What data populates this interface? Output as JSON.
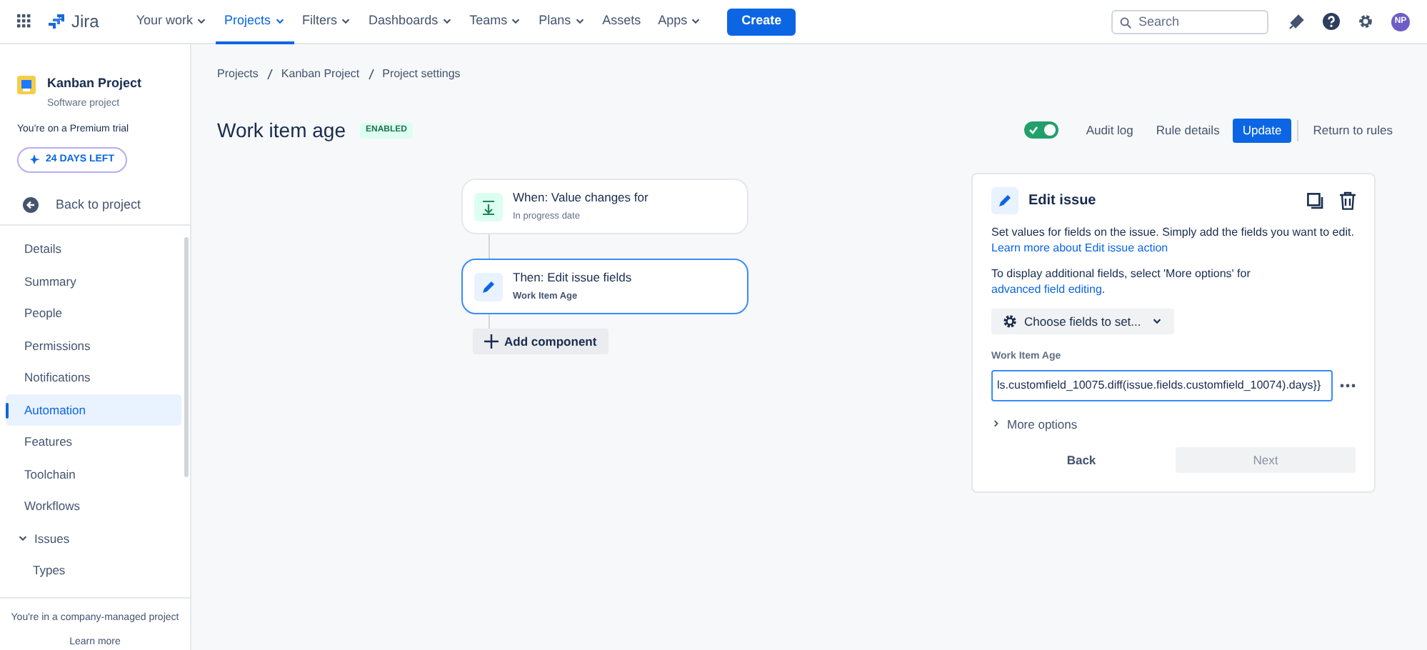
{
  "topbar": {
    "logo": "Jira",
    "nav": [
      {
        "label": "Your work",
        "dropdown": true,
        "selected": false
      },
      {
        "label": "Projects",
        "dropdown": true,
        "selected": true
      },
      {
        "label": "Filters",
        "dropdown": true,
        "selected": false
      },
      {
        "label": "Dashboards",
        "dropdown": true,
        "selected": false
      },
      {
        "label": "Teams",
        "dropdown": true,
        "selected": false
      },
      {
        "label": "Plans",
        "dropdown": true,
        "selected": false
      },
      {
        "label": "Assets",
        "dropdown": false,
        "selected": false
      },
      {
        "label": "Apps",
        "dropdown": true,
        "selected": false
      }
    ],
    "create": "Create",
    "search": {
      "placeholder": "Search"
    },
    "avatar": "NP"
  },
  "sidebar": {
    "project": {
      "name": "Kanban Project",
      "type": "Software project"
    },
    "trial": "You're on a Premium trial",
    "days_left": "24 DAYS LEFT",
    "back": "Back to project",
    "items": [
      {
        "label": "Details",
        "selected": false
      },
      {
        "label": "Summary",
        "selected": false
      },
      {
        "label": "People",
        "selected": false
      },
      {
        "label": "Permissions",
        "selected": false
      },
      {
        "label": "Notifications",
        "selected": false
      },
      {
        "label": "Automation",
        "selected": true
      },
      {
        "label": "Features",
        "selected": false
      },
      {
        "label": "Toolchain",
        "selected": false
      },
      {
        "label": "Workflows",
        "selected": false
      },
      {
        "label": "Issues",
        "selected": false,
        "expanded": true,
        "children": [
          {
            "label": "Types",
            "selected": false
          }
        ]
      }
    ],
    "footer": "You're in a company-managed project",
    "footer_link": "Learn more"
  },
  "breadcrumbs": [
    "Projects",
    "Kanban Project",
    "Project settings"
  ],
  "rule": {
    "title": "Work item age",
    "status": "ENABLED",
    "enabled": true
  },
  "actions": {
    "audit_log": "Audit log",
    "rule_details": "Rule details",
    "update": "Update",
    "return": "Return to rules"
  },
  "flow": [
    {
      "kind": "trigger",
      "title": "When: Value changes for",
      "subtitle": "In progress date",
      "selected": false
    },
    {
      "kind": "action",
      "title": "Then: Edit issue fields",
      "subtitle": "Work Item Age",
      "selected": true
    }
  ],
  "add_component": "Add component",
  "panel": {
    "title": "Edit issue",
    "description": "Set values for fields on the issue. Simply add the fields you want to edit.",
    "description_link": "Learn more about Edit issue action",
    "hint": "To display additional fields, select 'More options' for",
    "hint_link": "advanced field editing",
    "hint_end": ".",
    "choose": "Choose fields to set...",
    "field_label": "Work Item Age",
    "field_value": "ls.customfield_10075.diff(issue.fields.customfield_10074).days}}",
    "more_options": "More options",
    "back": "Back",
    "next": "Next",
    "next_disabled": true
  }
}
